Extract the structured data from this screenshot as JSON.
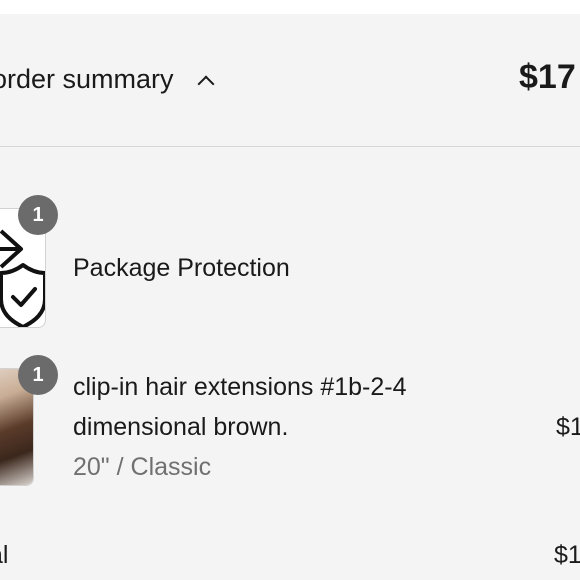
{
  "summary": {
    "toggle_label": "order summary",
    "total": "$17"
  },
  "items": [
    {
      "quantity": "1",
      "name": "Package Protection",
      "icon": "shield-check-icon"
    },
    {
      "quantity": "1",
      "name": "clip-in hair extensions #1b-2-4 dimensional brown.",
      "variant": "20\" / Classic",
      "price": "$1"
    }
  ],
  "subtotal": {
    "label": "tal",
    "value": "$1"
  }
}
